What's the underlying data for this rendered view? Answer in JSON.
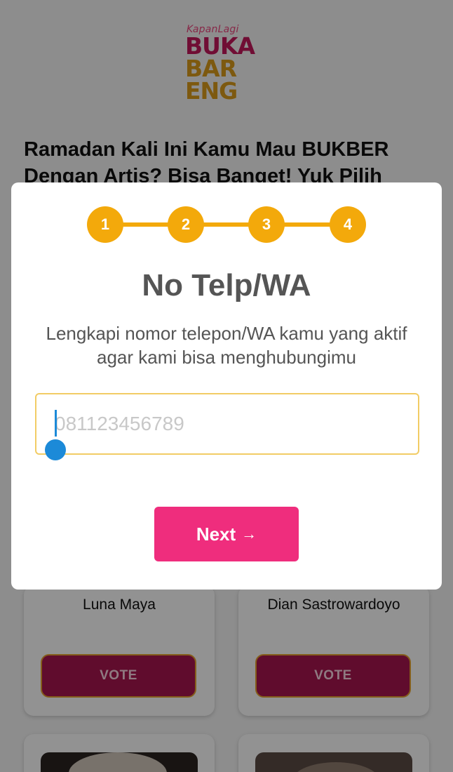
{
  "logo": {
    "brand": "KapanLagi",
    "lines": [
      "BUKA",
      "BAR",
      "ENG"
    ],
    "colors": [
      "#c2185b",
      "#d79a1a"
    ]
  },
  "headline": "Ramadan Kali Ini Kamu Mau BUKBER Dengan Artis? Bisa Banget! Yuk Pilih",
  "cards": [
    {
      "name": "Luna Maya",
      "vote_label": "VOTE"
    },
    {
      "name": "Dian Sastrowardoyo",
      "vote_label": "VOTE"
    }
  ],
  "modal": {
    "steps": [
      "1",
      "2",
      "3",
      "4"
    ],
    "title": "No Telp/WA",
    "description": "Lengkapi nomor telepon/WA kamu yang aktif agar kami bisa menghubungimu",
    "phone": {
      "value": "",
      "placeholder": "081123456789"
    },
    "next": {
      "label": "Next",
      "arrow": "→"
    }
  },
  "colors": {
    "step_accent": "#f3a90b",
    "next_button": "#ef2d7d",
    "vote_button": "#a6154e",
    "caret": "#1c8ad8"
  }
}
